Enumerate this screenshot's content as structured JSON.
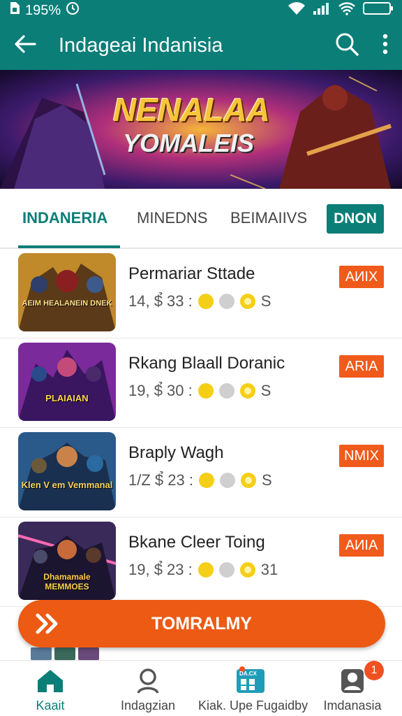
{
  "status_bar": {
    "battery_text": "195%",
    "icons": [
      "sim-icon",
      "alarm-icon",
      "wifi-icon",
      "signal-icon",
      "battery-icon"
    ]
  },
  "app_bar": {
    "title": "Indageai Indanisia",
    "icons": [
      "back-arrow-icon",
      "search-icon",
      "more-vert-icon"
    ]
  },
  "banner": {
    "line1": "NENALAA",
    "line2": "YOMALEIS"
  },
  "tabs": {
    "items": [
      "INDANERIA",
      "MINEDNS",
      "BEIMAIIVS"
    ],
    "button_label": "DNON"
  },
  "list": {
    "items": [
      {
        "title": "Permariar Sttade",
        "meta": "14, $̉ 33 :",
        "suffix": "S",
        "badge": "AИIX",
        "thumb_text": "AEIM HEALANEIN DNEK"
      },
      {
        "title": "Rkang Blaall Doranic",
        "meta": "19, $̉ 30 :",
        "suffix": "S",
        "badge": "ARIA",
        "thumb_text": "PLAIAIAN"
      },
      {
        "title": "Braply Wagh",
        "meta": "1/Z $̉ 23 :",
        "suffix": "S",
        "badge": "NMIX",
        "thumb_text": "Klen V em Vemmanal"
      },
      {
        "title": "Bkane Cleer Toing",
        "meta": "19, $̉ 23 :",
        "suffix": "31",
        "badge": "AИIA",
        "thumb_text": "Dhamamale MEMMOES"
      }
    ]
  },
  "cta": {
    "label": "TOMRALMY"
  },
  "bottom_nav": {
    "items": [
      {
        "label": "Kaait",
        "icon": "home-icon",
        "active": true
      },
      {
        "label": "Indagzian",
        "icon": "person-icon",
        "active": false
      },
      {
        "label": "Kiak. Upe Fugaidby",
        "icon": "grid-app-icon",
        "active": false,
        "icon_text": "DA.CX"
      },
      {
        "label": "Imdanasia",
        "icon": "account-icon",
        "active": false,
        "badge": "1"
      }
    ]
  },
  "colors": {
    "primary": "#0b7e78",
    "accent": "#ec5a14",
    "badge": "#f05a1a"
  }
}
